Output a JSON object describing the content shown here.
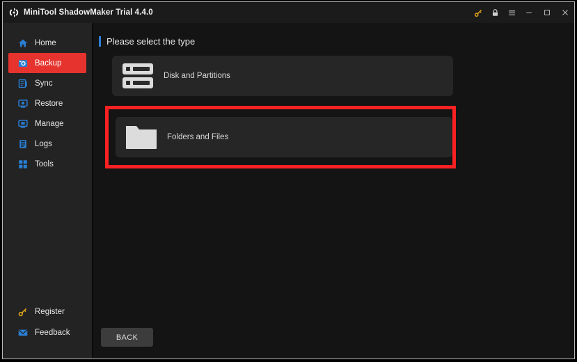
{
  "window": {
    "title": "MiniTool ShadowMaker Trial 4.4.0",
    "logo_icon": "sync-arrows-logo-icon",
    "controls": [
      {
        "name": "key-icon",
        "label": "Register key"
      },
      {
        "name": "lock-icon",
        "label": "Lock"
      },
      {
        "name": "menu-icon",
        "label": "Menu"
      },
      {
        "name": "minimize-icon",
        "label": "Minimize"
      },
      {
        "name": "maximize-icon",
        "label": "Maximize"
      },
      {
        "name": "close-icon",
        "label": "Close"
      }
    ]
  },
  "sidebar": {
    "items": [
      {
        "label": "Home",
        "icon": "home-icon",
        "active": false
      },
      {
        "label": "Backup",
        "icon": "backup-icon",
        "active": true
      },
      {
        "label": "Sync",
        "icon": "sync-icon",
        "active": false
      },
      {
        "label": "Restore",
        "icon": "restore-icon",
        "active": false
      },
      {
        "label": "Manage",
        "icon": "manage-icon",
        "active": false
      },
      {
        "label": "Logs",
        "icon": "logs-icon",
        "active": false
      },
      {
        "label": "Tools",
        "icon": "tools-icon",
        "active": false
      }
    ],
    "bottom_items": [
      {
        "label": "Register",
        "icon": "key-icon"
      },
      {
        "label": "Feedback",
        "icon": "envelope-icon"
      }
    ]
  },
  "main": {
    "section_title": "Please select the type",
    "cards": [
      {
        "label": "Disk and Partitions",
        "icon": "disk-partitions-icon",
        "highlighted": false
      },
      {
        "label": "Folders and Files",
        "icon": "folder-icon",
        "highlighted": true
      }
    ],
    "back_label": "BACK"
  },
  "colors": {
    "accent_blue": "#2f7fd8",
    "active_red": "#e6332e",
    "annotation_red": "#fa2122",
    "icon_blue": "#2a7fd4",
    "key_gold": "#e0a319",
    "sidebar_bg": "#232323",
    "main_bg": "#141414",
    "card_bg": "#262626"
  }
}
